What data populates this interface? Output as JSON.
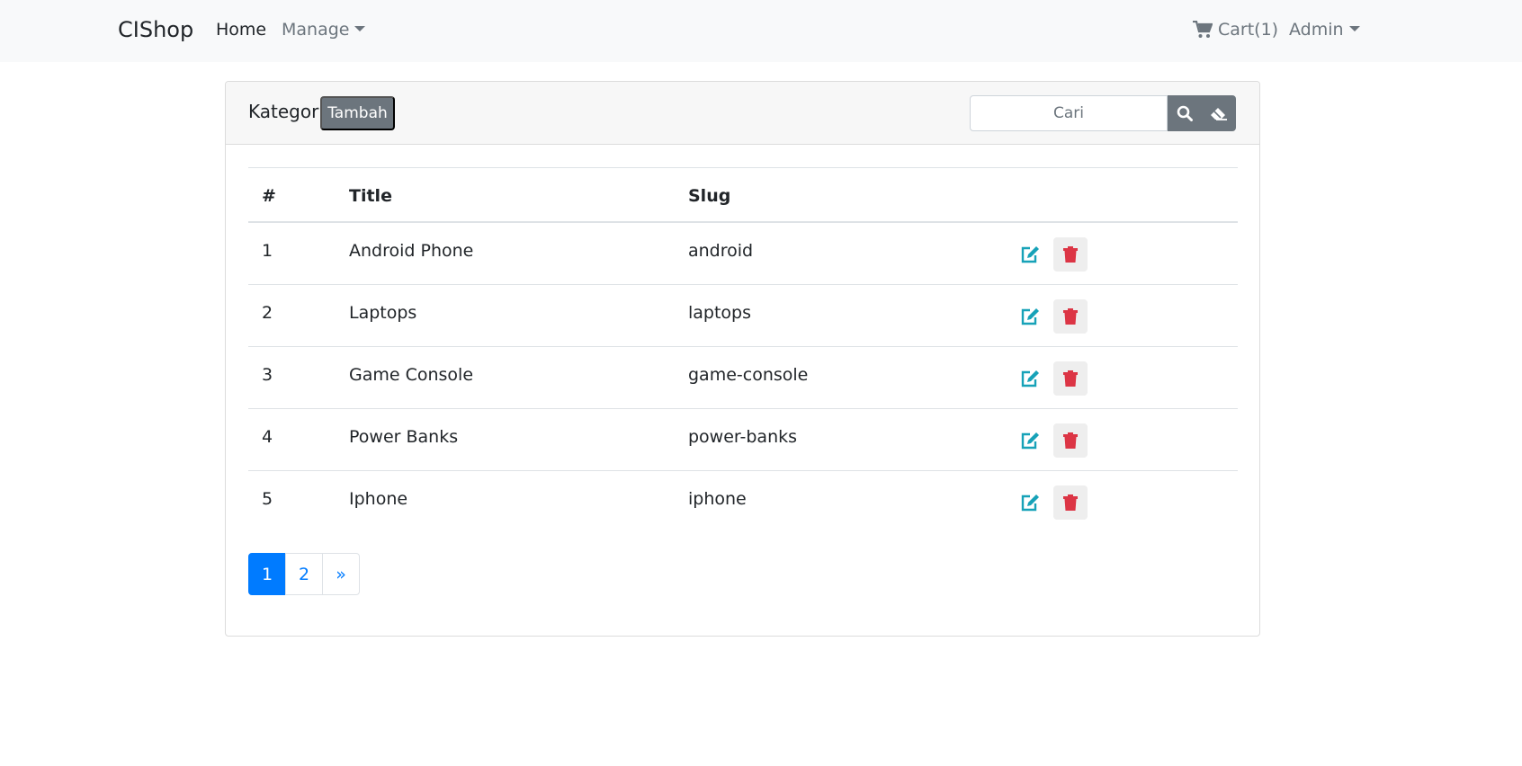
{
  "navbar": {
    "brand": "CIShop",
    "home": "Home",
    "manage": "Manage",
    "cart": "Cart(1)",
    "admin": "Admin"
  },
  "card": {
    "title": "Kategori",
    "add_button": "Tambah",
    "search_placeholder": "Cari"
  },
  "table": {
    "headers": [
      "#",
      "Title",
      "Slug",
      ""
    ],
    "rows": [
      {
        "num": "1",
        "title": "Android Phone",
        "slug": "android"
      },
      {
        "num": "2",
        "title": "Laptops",
        "slug": "laptops"
      },
      {
        "num": "3",
        "title": "Game Console",
        "slug": "game-console"
      },
      {
        "num": "4",
        "title": "Power Banks",
        "slug": "power-banks"
      },
      {
        "num": "5",
        "title": "Iphone",
        "slug": "iphone"
      }
    ]
  },
  "pagination": {
    "pages": [
      "1",
      "2",
      "»"
    ],
    "active": "1"
  },
  "colors": {
    "edit": "#17a2b8",
    "delete": "#dc3545",
    "primary": "#007bff",
    "secondary": "#6c757d"
  }
}
